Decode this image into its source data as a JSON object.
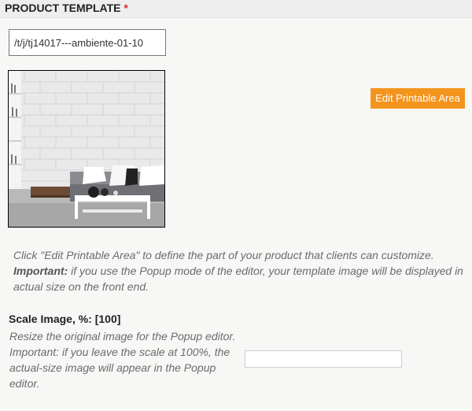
{
  "header": {
    "title": "PRODUCT TEMPLATE",
    "required_marker": "*"
  },
  "template": {
    "image_path": "/t/j/tj14017---ambiente-01-10"
  },
  "buttons": {
    "edit_printable_area": "Edit Printable Area"
  },
  "help": {
    "line1": "Click \"Edit Printable Area\" to define the part of your product that clients can customize.",
    "important_label": "Important:",
    "line2": " if you use the Popup mode of the editor, your template image will be displayed in actual size on the front end."
  },
  "scale": {
    "label": "Scale Image, %: [100]",
    "desc1": "Resize the original image for the Popup editor.",
    "desc2": "Important: if you leave the scale at 100%, the actual-size image will appear in the Popup editor.",
    "value": ""
  },
  "colors": {
    "accent_button": "#f3941d",
    "required": "#e02b27"
  }
}
